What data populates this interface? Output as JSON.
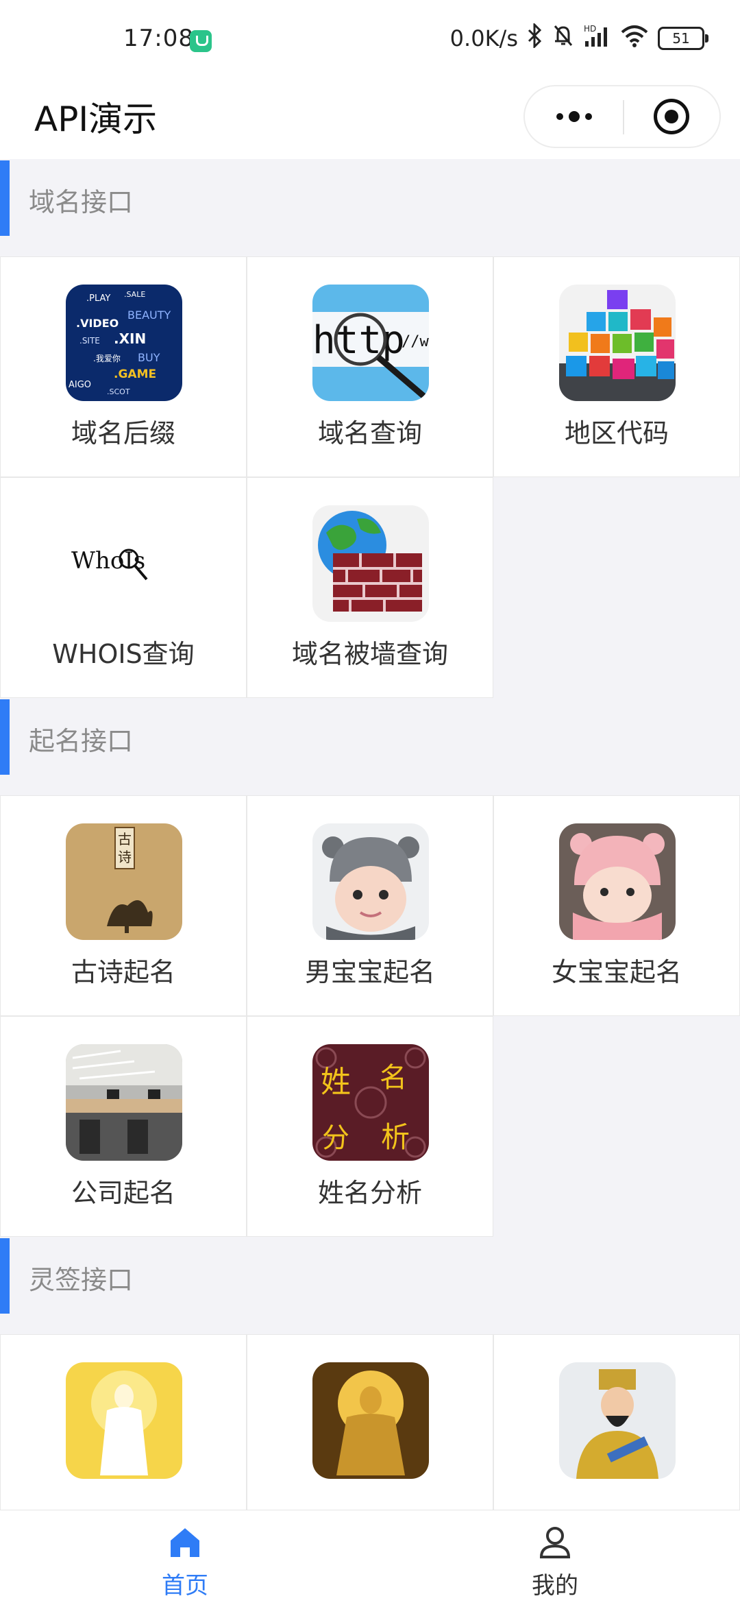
{
  "status_bar": {
    "time": "17:08",
    "network_speed": "0.0K/s",
    "battery": "51",
    "icons": [
      "notification-app-icon",
      "bluetooth-icon",
      "mute-bell-icon",
      "hd-signal-icon",
      "wifi-icon",
      "battery-icon"
    ]
  },
  "nav": {
    "title": "API演示",
    "capsule_icons": [
      "more-dots-icon",
      "close-target-icon"
    ]
  },
  "sections": [
    {
      "title": "域名接口",
      "items": [
        {
          "label": "域名后缀",
          "icon": "domain-suffix-thumb"
        },
        {
          "label": "域名查询",
          "icon": "http-magnifier-thumb"
        },
        {
          "label": "地区代码",
          "icon": "region-code-cubes-thumb"
        },
        {
          "label": "WHOIS查询",
          "icon": "whois-logo-thumb",
          "logo_text": "WhoIs"
        },
        {
          "label": "域名被墙查询",
          "icon": "globe-firewall-thumb"
        }
      ]
    },
    {
      "title": "起名接口",
      "items": [
        {
          "label": "古诗起名",
          "icon": "ancient-poem-book-thumb"
        },
        {
          "label": "男宝宝起名",
          "icon": "baby-boy-thumb"
        },
        {
          "label": "女宝宝起名",
          "icon": "baby-girl-thumb"
        },
        {
          "label": "公司起名",
          "icon": "office-room-thumb"
        },
        {
          "label": "姓名分析",
          "icon": "name-analysis-calligraphy-thumb"
        }
      ]
    },
    {
      "title": "灵签接口",
      "items": [
        {
          "label": "",
          "icon": "guanyin-thumb"
        },
        {
          "label": "",
          "icon": "golden-buddha-thumb"
        },
        {
          "label": "",
          "icon": "emperor-figure-thumb"
        }
      ]
    }
  ],
  "tabbar": {
    "tabs": [
      {
        "label": "首页",
        "icon": "home-icon",
        "active": true
      },
      {
        "label": "我的",
        "icon": "user-icon",
        "active": false
      }
    ],
    "active_color": "#2f7cf6",
    "inactive_color": "#333333"
  },
  "colors": {
    "accent": "#2f7cf6",
    "background": "#f3f3f7"
  }
}
